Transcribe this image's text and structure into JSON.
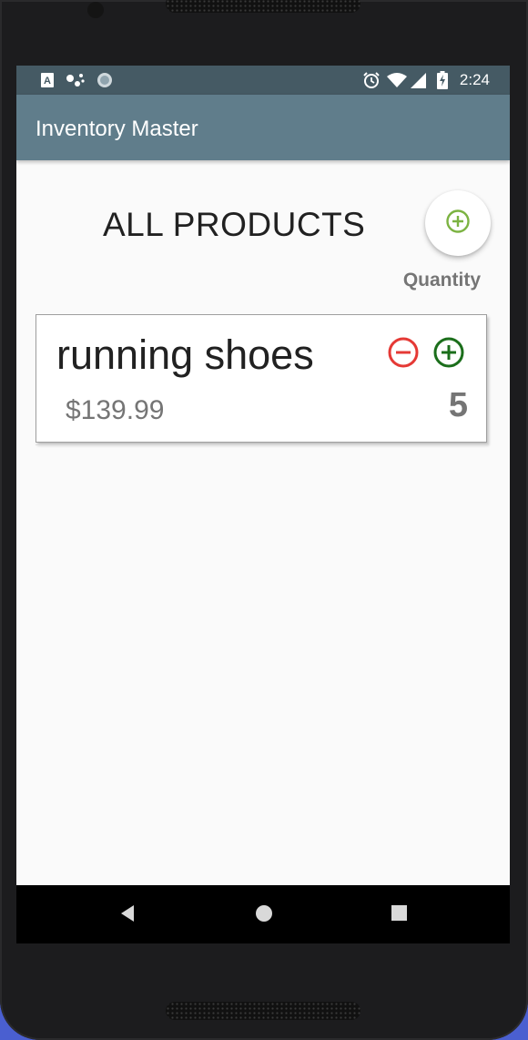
{
  "status_bar": {
    "time": "2:24",
    "left_icons": [
      "a-notification-icon",
      "assistant-dots-icon",
      "sync-circle-icon"
    ],
    "right_icons": [
      "alarm-icon",
      "wifi-icon",
      "signal-icon",
      "battery-charging-icon"
    ]
  },
  "app_bar": {
    "title": "Inventory Master"
  },
  "main": {
    "heading": "ALL PRODUCTS",
    "add_button_icon": "add-circle-icon",
    "quantity_header": "Quantity",
    "products": [
      {
        "name": "running shoes",
        "price": "$139.99",
        "quantity": "5"
      }
    ]
  },
  "nav_bar": {
    "buttons": [
      "back-icon",
      "home-icon",
      "recents-icon"
    ]
  },
  "colors": {
    "status_bar": "#455a64",
    "app_bar": "#607d8b",
    "decrease": "#e53935",
    "increase": "#1b6e1b",
    "fab_icon": "#7cb342"
  }
}
